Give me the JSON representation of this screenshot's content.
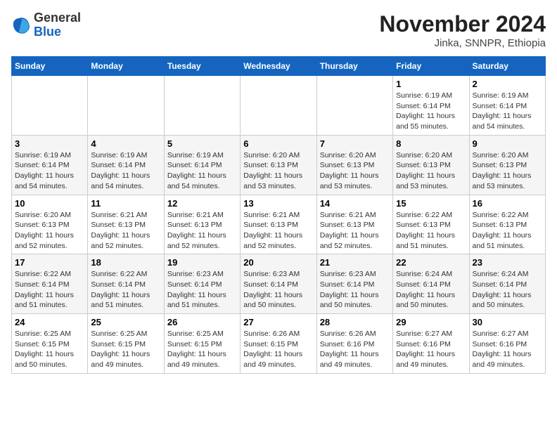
{
  "logo": {
    "general": "General",
    "blue": "Blue"
  },
  "title": "November 2024",
  "location": "Jinka, SNNPR, Ethiopia",
  "weekdays": [
    "Sunday",
    "Monday",
    "Tuesday",
    "Wednesday",
    "Thursday",
    "Friday",
    "Saturday"
  ],
  "weeks": [
    [
      {
        "day": "",
        "info": ""
      },
      {
        "day": "",
        "info": ""
      },
      {
        "day": "",
        "info": ""
      },
      {
        "day": "",
        "info": ""
      },
      {
        "day": "",
        "info": ""
      },
      {
        "day": "1",
        "info": "Sunrise: 6:19 AM\nSunset: 6:14 PM\nDaylight: 11 hours and 55 minutes."
      },
      {
        "day": "2",
        "info": "Sunrise: 6:19 AM\nSunset: 6:14 PM\nDaylight: 11 hours and 54 minutes."
      }
    ],
    [
      {
        "day": "3",
        "info": "Sunrise: 6:19 AM\nSunset: 6:14 PM\nDaylight: 11 hours and 54 minutes."
      },
      {
        "day": "4",
        "info": "Sunrise: 6:19 AM\nSunset: 6:14 PM\nDaylight: 11 hours and 54 minutes."
      },
      {
        "day": "5",
        "info": "Sunrise: 6:19 AM\nSunset: 6:14 PM\nDaylight: 11 hours and 54 minutes."
      },
      {
        "day": "6",
        "info": "Sunrise: 6:20 AM\nSunset: 6:13 PM\nDaylight: 11 hours and 53 minutes."
      },
      {
        "day": "7",
        "info": "Sunrise: 6:20 AM\nSunset: 6:13 PM\nDaylight: 11 hours and 53 minutes."
      },
      {
        "day": "8",
        "info": "Sunrise: 6:20 AM\nSunset: 6:13 PM\nDaylight: 11 hours and 53 minutes."
      },
      {
        "day": "9",
        "info": "Sunrise: 6:20 AM\nSunset: 6:13 PM\nDaylight: 11 hours and 53 minutes."
      }
    ],
    [
      {
        "day": "10",
        "info": "Sunrise: 6:20 AM\nSunset: 6:13 PM\nDaylight: 11 hours and 52 minutes."
      },
      {
        "day": "11",
        "info": "Sunrise: 6:21 AM\nSunset: 6:13 PM\nDaylight: 11 hours and 52 minutes."
      },
      {
        "day": "12",
        "info": "Sunrise: 6:21 AM\nSunset: 6:13 PM\nDaylight: 11 hours and 52 minutes."
      },
      {
        "day": "13",
        "info": "Sunrise: 6:21 AM\nSunset: 6:13 PM\nDaylight: 11 hours and 52 minutes."
      },
      {
        "day": "14",
        "info": "Sunrise: 6:21 AM\nSunset: 6:13 PM\nDaylight: 11 hours and 52 minutes."
      },
      {
        "day": "15",
        "info": "Sunrise: 6:22 AM\nSunset: 6:13 PM\nDaylight: 11 hours and 51 minutes."
      },
      {
        "day": "16",
        "info": "Sunrise: 6:22 AM\nSunset: 6:13 PM\nDaylight: 11 hours and 51 minutes."
      }
    ],
    [
      {
        "day": "17",
        "info": "Sunrise: 6:22 AM\nSunset: 6:14 PM\nDaylight: 11 hours and 51 minutes."
      },
      {
        "day": "18",
        "info": "Sunrise: 6:22 AM\nSunset: 6:14 PM\nDaylight: 11 hours and 51 minutes."
      },
      {
        "day": "19",
        "info": "Sunrise: 6:23 AM\nSunset: 6:14 PM\nDaylight: 11 hours and 51 minutes."
      },
      {
        "day": "20",
        "info": "Sunrise: 6:23 AM\nSunset: 6:14 PM\nDaylight: 11 hours and 50 minutes."
      },
      {
        "day": "21",
        "info": "Sunrise: 6:23 AM\nSunset: 6:14 PM\nDaylight: 11 hours and 50 minutes."
      },
      {
        "day": "22",
        "info": "Sunrise: 6:24 AM\nSunset: 6:14 PM\nDaylight: 11 hours and 50 minutes."
      },
      {
        "day": "23",
        "info": "Sunrise: 6:24 AM\nSunset: 6:14 PM\nDaylight: 11 hours and 50 minutes."
      }
    ],
    [
      {
        "day": "24",
        "info": "Sunrise: 6:25 AM\nSunset: 6:15 PM\nDaylight: 11 hours and 50 minutes."
      },
      {
        "day": "25",
        "info": "Sunrise: 6:25 AM\nSunset: 6:15 PM\nDaylight: 11 hours and 49 minutes."
      },
      {
        "day": "26",
        "info": "Sunrise: 6:25 AM\nSunset: 6:15 PM\nDaylight: 11 hours and 49 minutes."
      },
      {
        "day": "27",
        "info": "Sunrise: 6:26 AM\nSunset: 6:15 PM\nDaylight: 11 hours and 49 minutes."
      },
      {
        "day": "28",
        "info": "Sunrise: 6:26 AM\nSunset: 6:16 PM\nDaylight: 11 hours and 49 minutes."
      },
      {
        "day": "29",
        "info": "Sunrise: 6:27 AM\nSunset: 6:16 PM\nDaylight: 11 hours and 49 minutes."
      },
      {
        "day": "30",
        "info": "Sunrise: 6:27 AM\nSunset: 6:16 PM\nDaylight: 11 hours and 49 minutes."
      }
    ]
  ]
}
